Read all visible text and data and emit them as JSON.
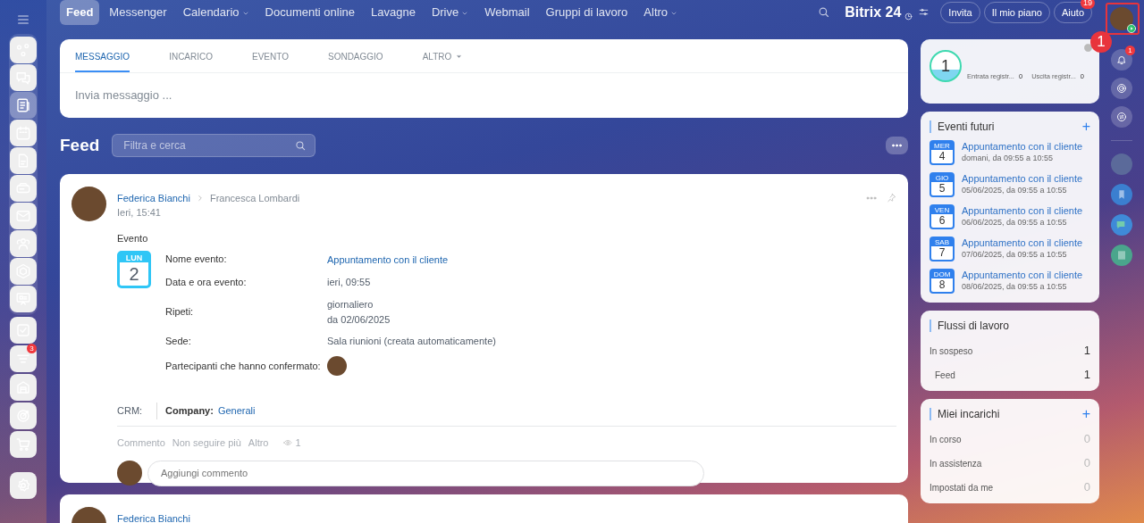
{
  "top_nav": {
    "items": [
      {
        "label": "Feed",
        "selected": true,
        "dropdown": false
      },
      {
        "label": "Messenger",
        "selected": false,
        "dropdown": false
      },
      {
        "label": "Calendario",
        "selected": false,
        "dropdown": true
      },
      {
        "label": "Documenti online",
        "selected": false,
        "dropdown": false
      },
      {
        "label": "Lavagne",
        "selected": false,
        "dropdown": false
      },
      {
        "label": "Drive",
        "selected": false,
        "dropdown": true
      },
      {
        "label": "Webmail",
        "selected": false,
        "dropdown": false
      },
      {
        "label": "Gruppi di lavoro",
        "selected": false,
        "dropdown": false
      },
      {
        "label": "Altro",
        "selected": false,
        "dropdown": true
      }
    ],
    "logo": {
      "name": "Bitrix",
      "number": "24"
    },
    "buttons": [
      {
        "label": "Invita"
      },
      {
        "label": "Il mio piano"
      },
      {
        "label": "Aiuto",
        "badge": "19"
      }
    ],
    "annotation": "1"
  },
  "sidebar": {
    "items": [
      {
        "selected": false
      },
      {
        "selected": false
      },
      {
        "selected": true
      },
      {
        "selected": false
      },
      {
        "selected": false
      },
      {
        "selected": false
      },
      {
        "selected": false
      },
      {
        "selected": false
      },
      {
        "selected": false
      },
      {
        "selected": false
      },
      {
        "selected": false
      },
      {
        "selected": false,
        "badge": "3"
      },
      {
        "selected": false
      },
      {
        "selected": false
      },
      {
        "selected": false
      }
    ]
  },
  "composer": {
    "tabs": [
      {
        "label": "MESSAGGIO",
        "selected": true,
        "dropdown": false
      },
      {
        "label": "INCARICO",
        "selected": false,
        "dropdown": false
      },
      {
        "label": "EVENTO",
        "selected": false,
        "dropdown": false
      },
      {
        "label": "SONDAGGIO",
        "selected": false,
        "dropdown": false
      },
      {
        "label": "ALTRO",
        "selected": false,
        "dropdown": true
      }
    ],
    "placeholder": "Invia messaggio ..."
  },
  "feed": {
    "title": "Feed",
    "search": {
      "placeholder": "Filtra e cerca"
    },
    "posts": [
      {
        "author": "Federica Bianchi",
        "recipient": "Francesca Lombardi",
        "time": "Ieri, 15:41",
        "type": "Evento",
        "calendar": {
          "weekday": "LUN",
          "day": "2"
        },
        "fields": [
          {
            "label": "Nome evento:",
            "kind": "link",
            "lines": [
              "Appuntamento con il cliente"
            ]
          },
          {
            "label": "Data e ora evento:",
            "kind": "text",
            "lines": [
              "ieri, 09:55"
            ]
          },
          {
            "label": "Ripeti:",
            "kind": "text",
            "lines": [
              "giornaliero",
              "da 02/06/2025"
            ]
          },
          {
            "label": "Sede:",
            "kind": "text",
            "lines": [
              "Sala riunioni (creata automaticamente)"
            ]
          },
          {
            "label": "Partecipanti che hanno confermato:",
            "kind": "avatars"
          }
        ],
        "crm": {
          "label": "CRM:",
          "entity_label": "Company:",
          "entity": "Generali"
        },
        "actions": [
          "Commento",
          "Non seguire più",
          "Altro"
        ],
        "views": "1",
        "comment_placeholder": "Aggiungi commento"
      },
      {
        "author": "Federica Bianchi"
      }
    ]
  },
  "timeman": {
    "counter": "1",
    "items": [
      {
        "label": "Entrata registr...",
        "value": "0"
      },
      {
        "label": "Uscita registr...",
        "value": "0"
      }
    ]
  },
  "events": {
    "title": "Eventi futuri",
    "add_label": "+",
    "items": [
      {
        "weekday": "MER",
        "day": "4",
        "title": "Appuntamento con il cliente",
        "when": "domani, da 09:55 a 10:55"
      },
      {
        "weekday": "GIO",
        "day": "5",
        "title": "Appuntamento con il cliente",
        "when": "05/06/2025, da 09:55 a 10:55"
      },
      {
        "weekday": "VEN",
        "day": "6",
        "title": "Appuntamento con il cliente",
        "when": "06/06/2025, da 09:55 a 10:55"
      },
      {
        "weekday": "SAB",
        "day": "7",
        "title": "Appuntamento con il cliente",
        "when": "07/06/2025, da 09:55 a 10:55"
      },
      {
        "weekday": "DOM",
        "day": "8",
        "title": "Appuntamento con il cliente",
        "when": "08/06/2025, da 09:55 a 10:55"
      }
    ]
  },
  "workflows": {
    "title": "Flussi di lavoro",
    "rows": [
      {
        "label": "In sospeso",
        "count": "1",
        "children": [
          {
            "label": "Feed",
            "count": "1"
          }
        ]
      }
    ]
  },
  "tasks": {
    "title": "Miei incarichi",
    "add_label": "+",
    "rows": [
      {
        "label": "In corso",
        "count": "0",
        "muted": true
      },
      {
        "label": "In assistenza",
        "count": "0",
        "muted": true
      },
      {
        "label": "Impostati da me",
        "count": "0",
        "muted": true
      }
    ]
  },
  "right_bar": {
    "notifications_badge": "1"
  }
}
